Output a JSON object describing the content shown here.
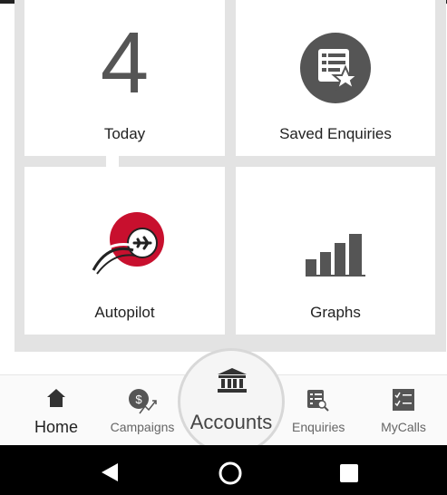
{
  "tiles": {
    "today": {
      "count": "4",
      "label": "Today"
    },
    "saved_enquiries": {
      "label": "Saved Enquiries"
    },
    "autopilot": {
      "label": "Autopilot"
    },
    "graphs": {
      "label": "Graphs"
    }
  },
  "tabs": {
    "home": {
      "label": "Home",
      "icon": "home-icon"
    },
    "campaigns": {
      "label": "Campaigns",
      "icon": "campaigns-icon"
    },
    "accounts": {
      "label": "Accounts",
      "icon": "bank-icon"
    },
    "enquiries": {
      "label": "Enquiries",
      "icon": "enquiries-icon"
    },
    "mycalls": {
      "label": "MyCalls",
      "icon": "checklist-icon"
    }
  },
  "colors": {
    "accent_red": "#c8102e",
    "icon_gray": "#555555",
    "tile_bg": "#e3e3e3"
  }
}
